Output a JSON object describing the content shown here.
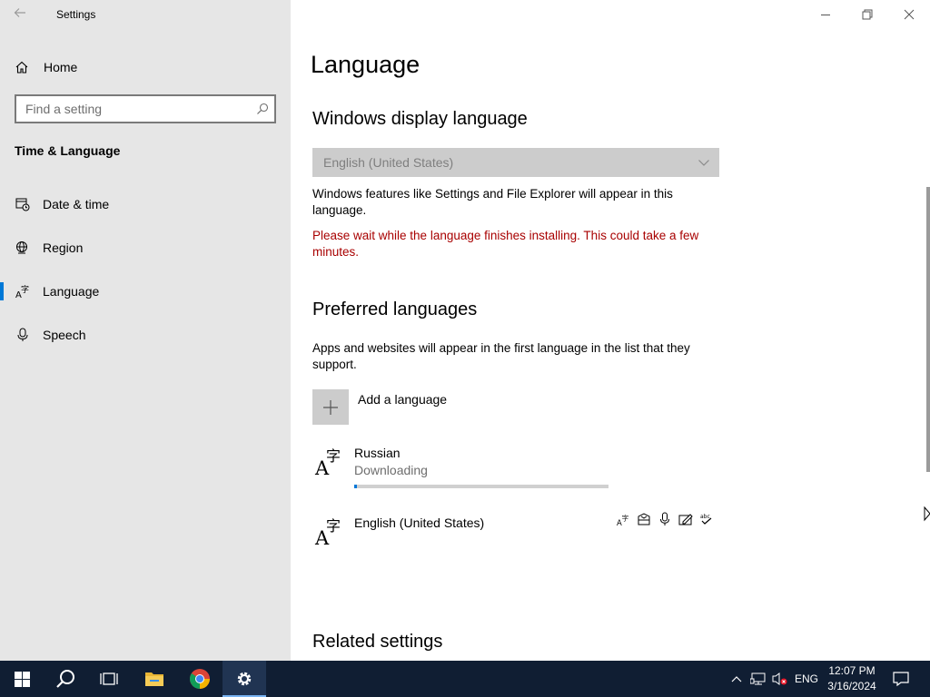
{
  "window": {
    "app_title": "Settings"
  },
  "sidebar": {
    "home_label": "Home",
    "search_placeholder": "Find a setting",
    "section_title": "Time & Language",
    "items": [
      {
        "label": "Date & time",
        "icon": "calendar-clock-icon"
      },
      {
        "label": "Region",
        "icon": "globe-icon"
      },
      {
        "label": "Language",
        "icon": "language-icon",
        "active": true
      },
      {
        "label": "Speech",
        "icon": "microphone-icon"
      }
    ]
  },
  "main": {
    "page_title": "Language",
    "display_language": {
      "heading": "Windows display language",
      "selected": "English (United States)",
      "description": "Windows features like Settings and File Explorer will appear in this language.",
      "warning": "Please wait while the language finishes installing. This could take a few minutes."
    },
    "preferred": {
      "heading": "Preferred languages",
      "description": "Apps and websites will appear in the first language in the list that they support.",
      "add_label": "Add a language",
      "languages": [
        {
          "name": "Russian",
          "status": "Downloading",
          "progress": 0.01
        },
        {
          "name": "English (United States)",
          "features": [
            "display-language-icon",
            "speech-recognition-icon",
            "microphone-icon",
            "handwriting-icon",
            "spellcheck-icon"
          ]
        }
      ]
    },
    "related_heading": "Related settings"
  },
  "taskbar": {
    "input_lang": "ENG",
    "time": "12:07 PM",
    "date": "3/16/2024"
  },
  "colors": {
    "accent": "#0078d7",
    "warning": "#a80000",
    "taskbar": "#101e33",
    "sidebar": "#e6e6e6"
  }
}
